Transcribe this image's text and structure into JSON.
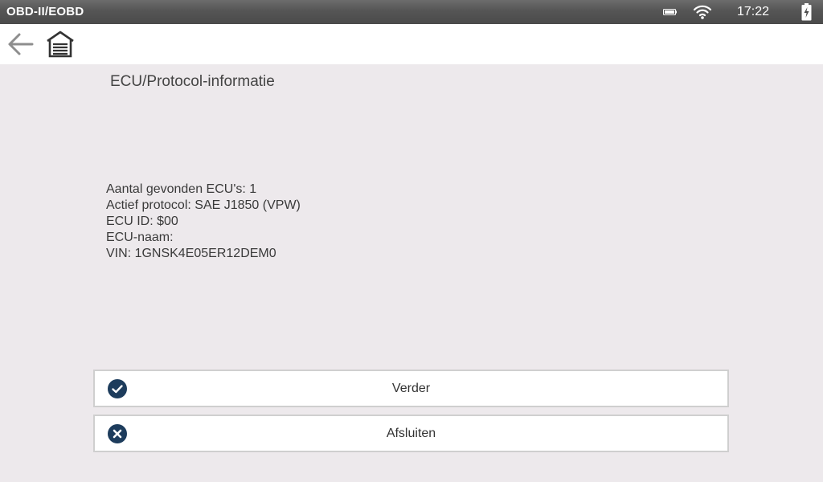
{
  "statusbar": {
    "app_title": "OBD-II/EOBD",
    "time": "17:22"
  },
  "toolbar": {
    "back_icon": "arrow-left-icon",
    "home_icon": "garage-home-icon"
  },
  "page": {
    "title": "ECU/Protocol-informatie",
    "info_lines": [
      "Aantal gevonden ECU's: 1",
      "Actief protocol: SAE J1850 (VPW)",
      "ECU ID: $00",
      "ECU-naam:",
      "VIN: 1GNSK4E05ER12DEM0"
    ]
  },
  "buttons": {
    "continue_label": "Verder",
    "continue_icon": "check-circle-icon",
    "close_label": "Afsluiten",
    "close_icon": "x-circle-icon"
  },
  "colors": {
    "accent": "#1d3c5c",
    "background": "#ede9ec",
    "statusbar": "#555555"
  }
}
